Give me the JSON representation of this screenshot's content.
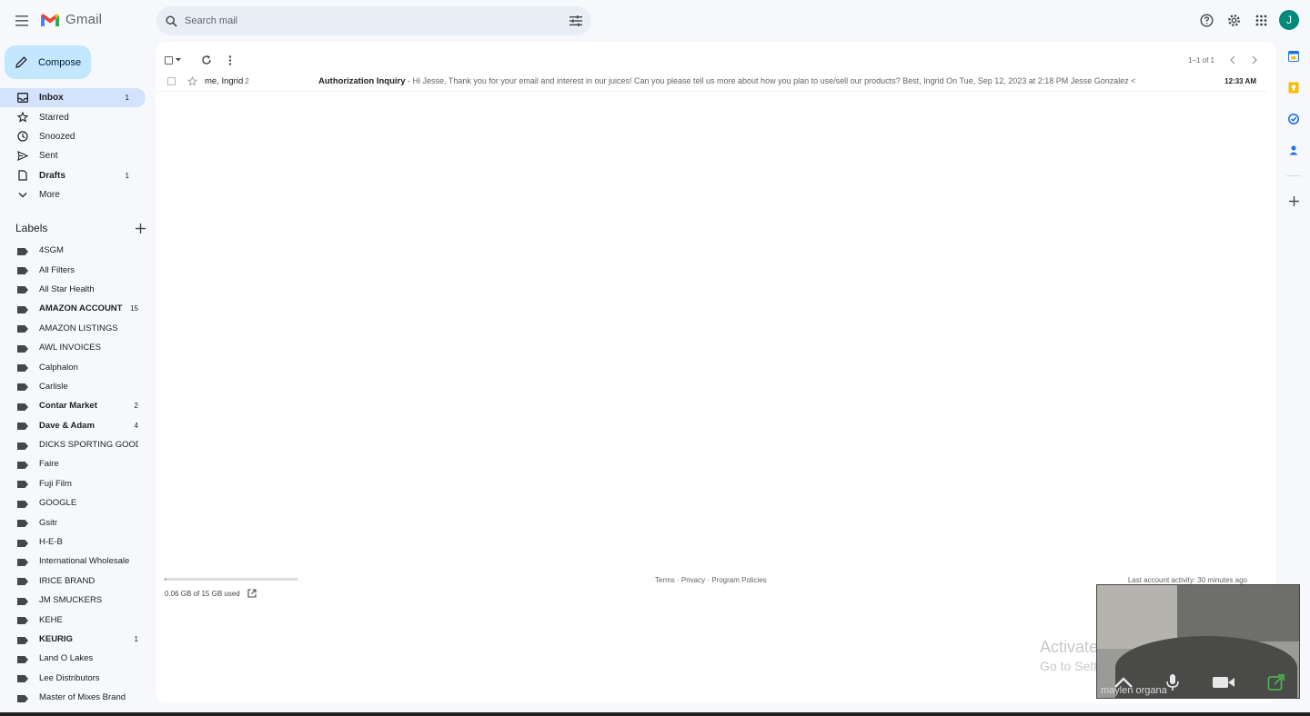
{
  "header": {
    "app_name": "Gmail",
    "search_placeholder": "Search mail",
    "avatar_letter": "J"
  },
  "compose": {
    "label": "Compose"
  },
  "nav": [
    {
      "name": "inbox",
      "label": "Inbox",
      "count": "1",
      "icon": "inbox-icon",
      "bold": true,
      "active": true
    },
    {
      "name": "starred",
      "label": "Starred",
      "count": "",
      "icon": "star-icon",
      "bold": false,
      "active": false
    },
    {
      "name": "snoozed",
      "label": "Snoozed",
      "count": "",
      "icon": "clock-icon",
      "bold": false,
      "active": false
    },
    {
      "name": "sent",
      "label": "Sent",
      "count": "",
      "icon": "send-icon",
      "bold": false,
      "active": false
    },
    {
      "name": "drafts",
      "label": "Drafts",
      "count": "1",
      "icon": "draft-icon",
      "bold": true,
      "active": false
    },
    {
      "name": "more",
      "label": "More",
      "count": "",
      "icon": "chevron-down-icon",
      "bold": false,
      "active": false
    }
  ],
  "labels_heading": "Labels",
  "labels": [
    {
      "label": "4SGM",
      "count": "",
      "bold": false
    },
    {
      "label": "All Filters",
      "count": "",
      "bold": false
    },
    {
      "label": "All Star Health",
      "count": "",
      "bold": false
    },
    {
      "label": "AMAZON ACCOUNT",
      "count": "15",
      "bold": true
    },
    {
      "label": "AMAZON LISTINGS",
      "count": "",
      "bold": false
    },
    {
      "label": "AWL INVOICES",
      "count": "",
      "bold": false
    },
    {
      "label": "Calphalon",
      "count": "",
      "bold": false
    },
    {
      "label": "Carlisle",
      "count": "",
      "bold": false
    },
    {
      "label": "Contar Market",
      "count": "2",
      "bold": true
    },
    {
      "label": "Dave & Adam",
      "count": "4",
      "bold": true
    },
    {
      "label": "DICKS SPORTING GOODS",
      "count": "",
      "bold": false
    },
    {
      "label": "Faire",
      "count": "",
      "bold": false
    },
    {
      "label": "Fuji Film",
      "count": "",
      "bold": false
    },
    {
      "label": "GOOGLE",
      "count": "",
      "bold": false
    },
    {
      "label": "Gsitr",
      "count": "",
      "bold": false
    },
    {
      "label": "H-E-B",
      "count": "",
      "bold": false
    },
    {
      "label": "International Wholesale",
      "count": "",
      "bold": false
    },
    {
      "label": "IRICE BRAND",
      "count": "",
      "bold": false
    },
    {
      "label": "JM SMUCKERS",
      "count": "",
      "bold": false
    },
    {
      "label": "KEHE",
      "count": "",
      "bold": false
    },
    {
      "label": "KEURIG",
      "count": "1",
      "bold": true
    },
    {
      "label": "Land O Lakes",
      "count": "",
      "bold": false
    },
    {
      "label": "Lee Distributors",
      "count": "",
      "bold": false
    },
    {
      "label": "Master of Mixes Brand",
      "count": "",
      "bold": false
    }
  ],
  "toolbar": {
    "range": "1–1 of 1"
  },
  "emails": [
    {
      "sender": "me, Ingrid",
      "thread_count": "2",
      "subject": "Authorization Inquiry",
      "snippet": " - Hi Jesse, Thank you for your email and interest in our juices! Can you please tell us more about how you plan to use/sell our products? Best, Ingrid On Tue, Sep 12, 2023 at 2:18 PM Jesse Gonzalez <",
      "time": "12:33 AM"
    }
  ],
  "footer": {
    "storage_text": "0.06 GB of 15 GB used",
    "storage_fraction": 0.004,
    "policies": "Terms · Privacy · Program Policies",
    "activity": "Last account activity: 30 minutes ago"
  },
  "overlay": {
    "video_name": "maylen organa",
    "activate_title": "Activate Windows",
    "activate_sub": "Go to Settings to activate Windows."
  },
  "colors": {
    "accent": "#0b57d0",
    "compose_bg": "#c2e7ff",
    "active_nav_bg": "#d3e3fd",
    "avatar_bg": "#00897b"
  }
}
